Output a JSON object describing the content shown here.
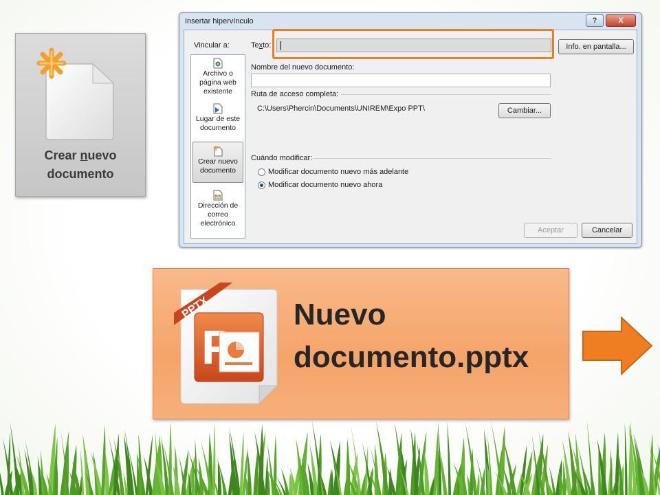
{
  "left_card": {
    "caption_line1_pre": "Crear ",
    "caption_line1_underlined": "n",
    "caption_line1_post": "uevo",
    "caption_line2": "documento",
    "icon": "new-document-icon"
  },
  "dialog": {
    "title": "Insertar hipervínculo",
    "help_label": "?",
    "close_label": "X",
    "vincular_label": "Vincular a:",
    "texto_label_pre": "Te",
    "texto_label_u": "x",
    "texto_label_post": "to:",
    "texto_value": "",
    "info_button": "Info. en pantalla...",
    "nombre_label": "Nombre del nuevo documento:",
    "nombre_value": "",
    "ruta_label": "Ruta de acceso completa:",
    "ruta_value": "C:\\Users\\Phercin\\Documents\\UNIREM\\Expo PPT\\",
    "cambiar_button": "Cambiar...",
    "cuando_label": "Cuándo modificar:",
    "radio_later": "Modificar documento nuevo más adelante",
    "radio_now": "Modificar documento nuevo ahora",
    "radio_selected": "now",
    "accept_button": "Aceptar",
    "cancel_button": "Cancelar",
    "sidebar": [
      {
        "label_line1": "Archivo o",
        "label_line2": "página web",
        "label_line3": "existente",
        "icon": "web-page-icon"
      },
      {
        "label_line1": "Lugar de este",
        "label_line2": "documento",
        "label_line3": "",
        "icon": "place-in-document-icon"
      },
      {
        "label_line1": "Crear nuevo",
        "label_line2": "documento",
        "label_line3": "",
        "icon": "new-document-icon",
        "selected": true
      },
      {
        "label_line1": "Dirección de",
        "label_line2": "correo",
        "label_line3": "electrónico",
        "icon": "email-icon"
      }
    ]
  },
  "pptx_card": {
    "title_line1": "Nuevo",
    "title_line2": "documento.pptx",
    "badge": "PPTX",
    "icon": "powerpoint-file-icon"
  },
  "colors": {
    "highlight": "#ef7d22",
    "pptx_card": "#f5a469",
    "arrow": "#ef7d22",
    "grass": "#5ea82f"
  }
}
